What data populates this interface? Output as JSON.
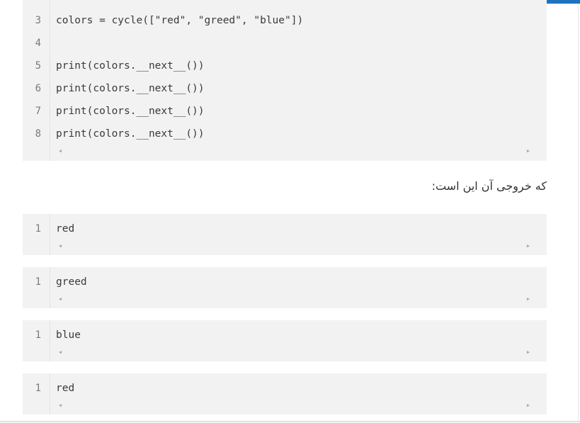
{
  "code_block_main": {
    "lines": [
      {
        "num": "3",
        "text": "colors = cycle([\"red\", \"greed\", \"blue\"])"
      },
      {
        "num": "4",
        "text": ""
      },
      {
        "num": "5",
        "text": "print(colors.__next__())"
      },
      {
        "num": "6",
        "text": "print(colors.__next__())"
      },
      {
        "num": "7",
        "text": "print(colors.__next__())"
      },
      {
        "num": "8",
        "text": "print(colors.__next__())"
      }
    ]
  },
  "paragraph": "که خروجی آن این است:",
  "output_blocks": [
    {
      "num": "1",
      "text": "red"
    },
    {
      "num": "1",
      "text": "greed"
    },
    {
      "num": "1",
      "text": "blue"
    },
    {
      "num": "1",
      "text": "red"
    }
  ],
  "icons": {
    "scroll_left": "◀",
    "scroll_right": "▶"
  },
  "colors": {
    "code_background": "#f2f2f2",
    "accent": "#1e73be"
  }
}
